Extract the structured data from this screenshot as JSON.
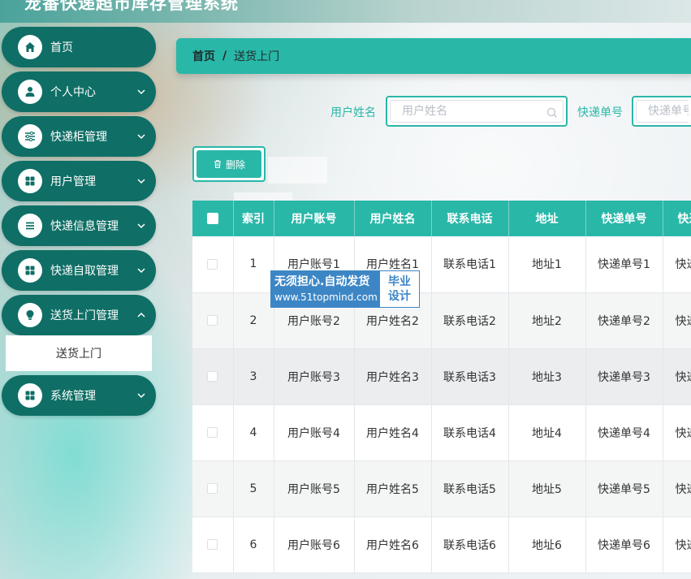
{
  "app": {
    "title": "宠番快递超市库存管理系统"
  },
  "sidebar": {
    "items": [
      {
        "label": "首页",
        "icon": "home-icon",
        "has_chevron": false
      },
      {
        "label": "个人中心",
        "icon": "user-icon",
        "has_chevron": true
      },
      {
        "label": "快递柜管理",
        "icon": "sliders-icon",
        "has_chevron": true
      },
      {
        "label": "用户管理",
        "icon": "grid-icon",
        "has_chevron": true
      },
      {
        "label": "快递信息管理",
        "icon": "list-icon",
        "has_chevron": true
      },
      {
        "label": "快递自取管理",
        "icon": "grid-icon",
        "has_chevron": true
      },
      {
        "label": "送货上门管理",
        "icon": "bulb-icon",
        "has_chevron": true
      },
      {
        "label": "系统管理",
        "icon": "grid-icon",
        "has_chevron": true
      }
    ],
    "active_submenu": "送货上门"
  },
  "breadcrumb": {
    "home": "首页",
    "separator": "/",
    "current": "送货上门"
  },
  "search": {
    "fields": [
      {
        "label": "用户姓名",
        "placeholder": "用户姓名"
      },
      {
        "label": "快递单号",
        "placeholder": "快递单号"
      }
    ]
  },
  "toolbar": {
    "delete_label": "删除"
  },
  "table": {
    "headers": [
      "",
      "索引",
      "用户账号",
      "用户姓名",
      "联系电话",
      "地址",
      "快递单号",
      "快递"
    ],
    "rows": [
      [
        "",
        "1",
        "用户账号1",
        "用户姓名1",
        "联系电话1",
        "地址1",
        "快递单号1",
        "快递"
      ],
      [
        "",
        "2",
        "用户账号2",
        "用户姓名2",
        "联系电话2",
        "地址2",
        "快递单号2",
        "快递"
      ],
      [
        "",
        "3",
        "用户账号3",
        "用户姓名3",
        "联系电话3",
        "地址3",
        "快递单号3",
        "快递"
      ],
      [
        "",
        "4",
        "用户账号4",
        "用户姓名4",
        "联系电话4",
        "地址4",
        "快递单号4",
        "快递"
      ],
      [
        "",
        "5",
        "用户账号5",
        "用户姓名5",
        "联系电话5",
        "地址5",
        "快递单号5",
        "快递"
      ],
      [
        "",
        "6",
        "用户账号6",
        "用户姓名6",
        "联系电话6",
        "地址6",
        "快递单号6",
        "快递"
      ]
    ]
  },
  "watermark": {
    "line1": "无须担心.自动发货",
    "line2": "www.51topmind.com",
    "right1": "毕业",
    "right2": "设计"
  },
  "colors": {
    "primary": "#29b7a8",
    "sidebar": "#0f6f66",
    "watermark": "#3d86c6"
  }
}
